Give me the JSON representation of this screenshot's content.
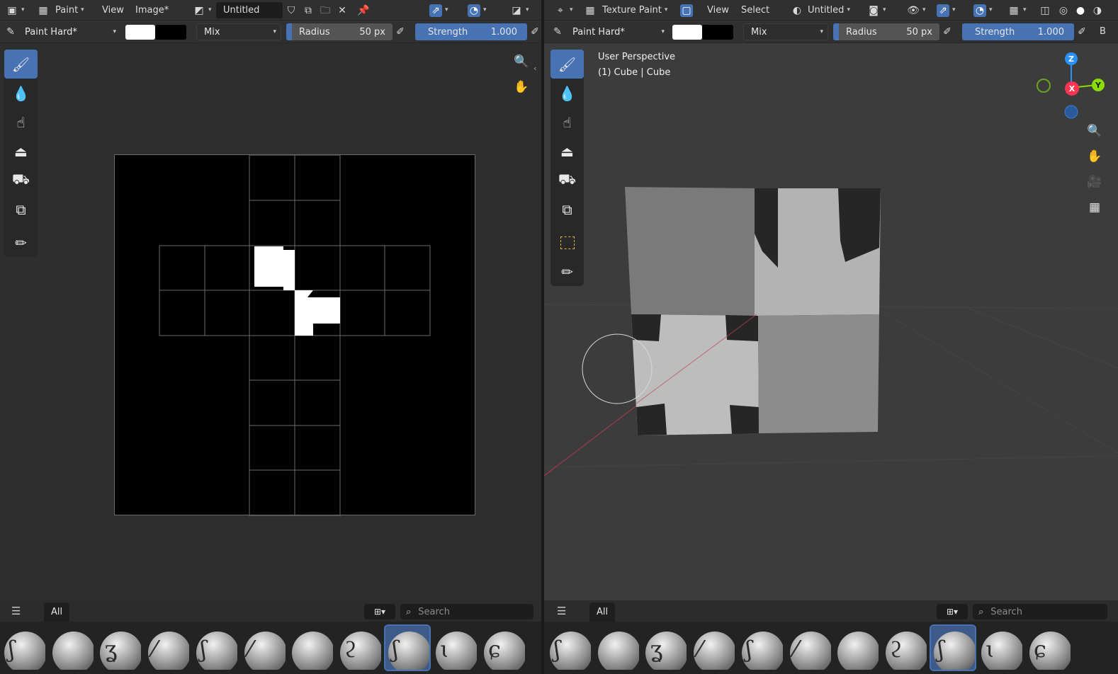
{
  "left_editor": {
    "header": {
      "mode": "Paint",
      "menus": [
        "View",
        "Image*"
      ],
      "image_name": "Untitled"
    },
    "tool_settings": {
      "brush": "Paint Hard*",
      "blend": "Mix",
      "radius_label": "Radius",
      "radius_value": "50 px",
      "strength_label": "Strength",
      "strength_value": "1.000"
    },
    "toolbar_icons": [
      "brush-draw-icon",
      "blur-icon",
      "smear-icon",
      "clone-stamp-icon",
      "fill-icon",
      "mask-icon",
      "annotate-icon"
    ],
    "asset_shelf": {
      "tab": "All",
      "search_placeholder": "Search",
      "active_index": 8
    }
  },
  "right_editor": {
    "header": {
      "mode": "Texture Paint",
      "menus": [
        "View",
        "Select"
      ],
      "image_name": "Untitled"
    },
    "tool_settings": {
      "brush": "Paint Hard*",
      "blend": "Mix",
      "radius_label": "Radius",
      "radius_value": "50 px",
      "strength_label": "Strength",
      "strength_value": "1.000",
      "overflow": "B"
    },
    "overlay": {
      "view_name": "User Perspective",
      "object_info": "(1) Cube | Cube"
    },
    "gizmo": {
      "z": "Z",
      "x": "X",
      "y": "Y"
    },
    "asset_shelf": {
      "tab": "All",
      "search_placeholder": "Search",
      "active_index": 8
    }
  },
  "colors": {
    "accent": "#4772b3",
    "primary_color": "#ffffff",
    "secondary_color": "#000000",
    "axis_x": "#ff3352",
    "axis_y": "#8bdc00",
    "axis_z": "#2890ff"
  }
}
